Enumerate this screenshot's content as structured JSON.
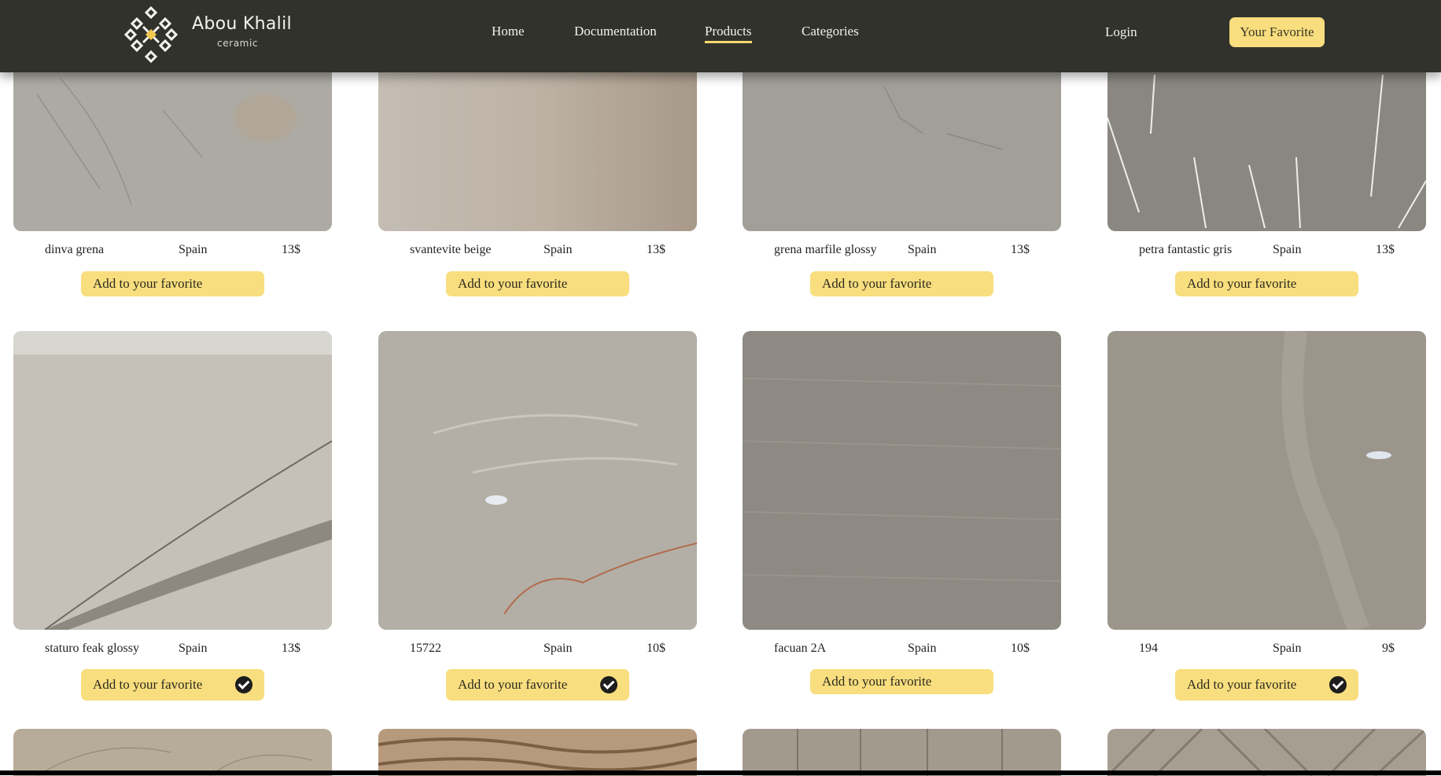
{
  "brand": {
    "name": "Abou Khalil",
    "tagline": "ceramic"
  },
  "nav": {
    "home": "Home",
    "documentation": "Documentation",
    "products": "Products",
    "categories": "Categories",
    "login": "Login",
    "favorite": "Your Favorite"
  },
  "colors": {
    "header": "#32322c",
    "accent": "#f8de7e",
    "active_underline": "#f5d76e"
  },
  "add_label": "Add to your favorite",
  "products": [
    {
      "name": "dinva grena",
      "origin": "Spain",
      "price": "13$",
      "favorited": false
    },
    {
      "name": "svantevite beige",
      "origin": "Spain",
      "price": "13$",
      "favorited": false
    },
    {
      "name": "grena marfile glossy",
      "origin": "Spain",
      "price": "13$",
      "favorited": false
    },
    {
      "name": "petra fantastic gris",
      "origin": "Spain",
      "price": "13$",
      "favorited": false
    },
    {
      "name": "staturo feak glossy",
      "origin": "Spain",
      "price": "13$",
      "favorited": true
    },
    {
      "name": "15722",
      "origin": "Spain",
      "price": "10$",
      "favorited": true
    },
    {
      "name": "facuan 2A",
      "origin": "Spain",
      "price": "10$",
      "favorited": false
    },
    {
      "name": "194",
      "origin": "Spain",
      "price": "9$",
      "favorited": true
    }
  ]
}
